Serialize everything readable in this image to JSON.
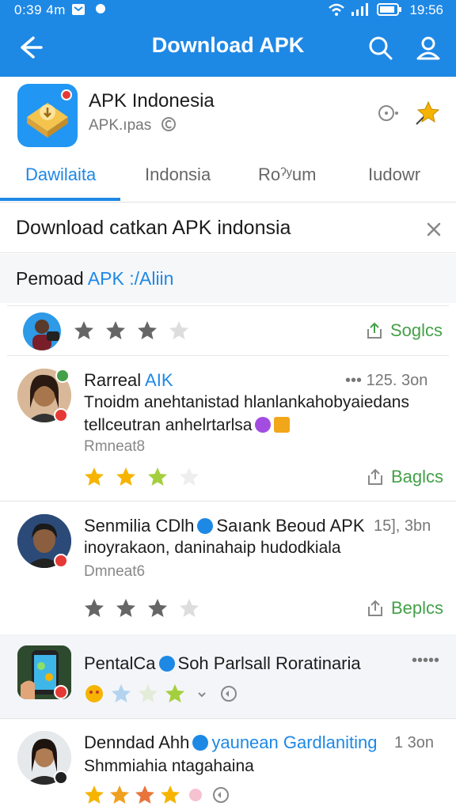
{
  "status_bar": {
    "time": "0:39 4m",
    "clock": "19:56"
  },
  "app_bar": {
    "title": "Download APK"
  },
  "app_info": {
    "name": "APK Indonesia",
    "subtitle": "APK.ıpas"
  },
  "tabs": [
    {
      "label": "Dawilaita",
      "active": true
    },
    {
      "label": "Indonsia",
      "active": false
    },
    {
      "label": "Roˀʸum",
      "active": false
    },
    {
      "label": "Iudowr",
      "active": false
    }
  ],
  "banner": {
    "text": "Download catkan APK indonsia"
  },
  "section": {
    "title_plain": "Pemoad ",
    "title_highlight": "APK :/Aliin"
  },
  "rating_card": {
    "stars_filled": 3,
    "stars_total": 4,
    "share_label": "Soglcs"
  },
  "comments": [
    {
      "name": "Rarreal",
      "name_highlight": "AIK",
      "time": "•••  125. 3on",
      "body_line1": "Tnoidm anehtanistad hlanlankahobyaiedans",
      "body_line2": "tellceutran anhelrtarlsa",
      "sub": "Rmneat8",
      "stars_filled": 3,
      "share_label": "Baglcs"
    },
    {
      "name": "Senmilia CDlh",
      "name_suffix": "Saıank Beoud APK",
      "time": "15], 3bn",
      "body_line1": "inoyrakaon, daninahaip hudodkiala",
      "body_line2": "",
      "sub": "Dmneat6",
      "stars_filled": 3,
      "share_label": "Beplcs"
    },
    {
      "name": "PentalCa",
      "name_suffix": "Soh Parlsall Roratinaria",
      "time": "•••••",
      "body_line1": "",
      "body_line2": "",
      "sub": "",
      "stars_filled": 0,
      "share_label": ""
    },
    {
      "name": "Denndad Ahh",
      "name_suffix": "yaunean Gardlaniting",
      "time": "1 3on",
      "body_line1": "Shmmiahia ntagahaina",
      "body_line2": "",
      "sub": "",
      "stars_filled": 4,
      "share_label": ""
    }
  ],
  "colors": {
    "primary": "#1e88e5",
    "accent_green": "#43a047",
    "star_gold": "#f6b400"
  }
}
